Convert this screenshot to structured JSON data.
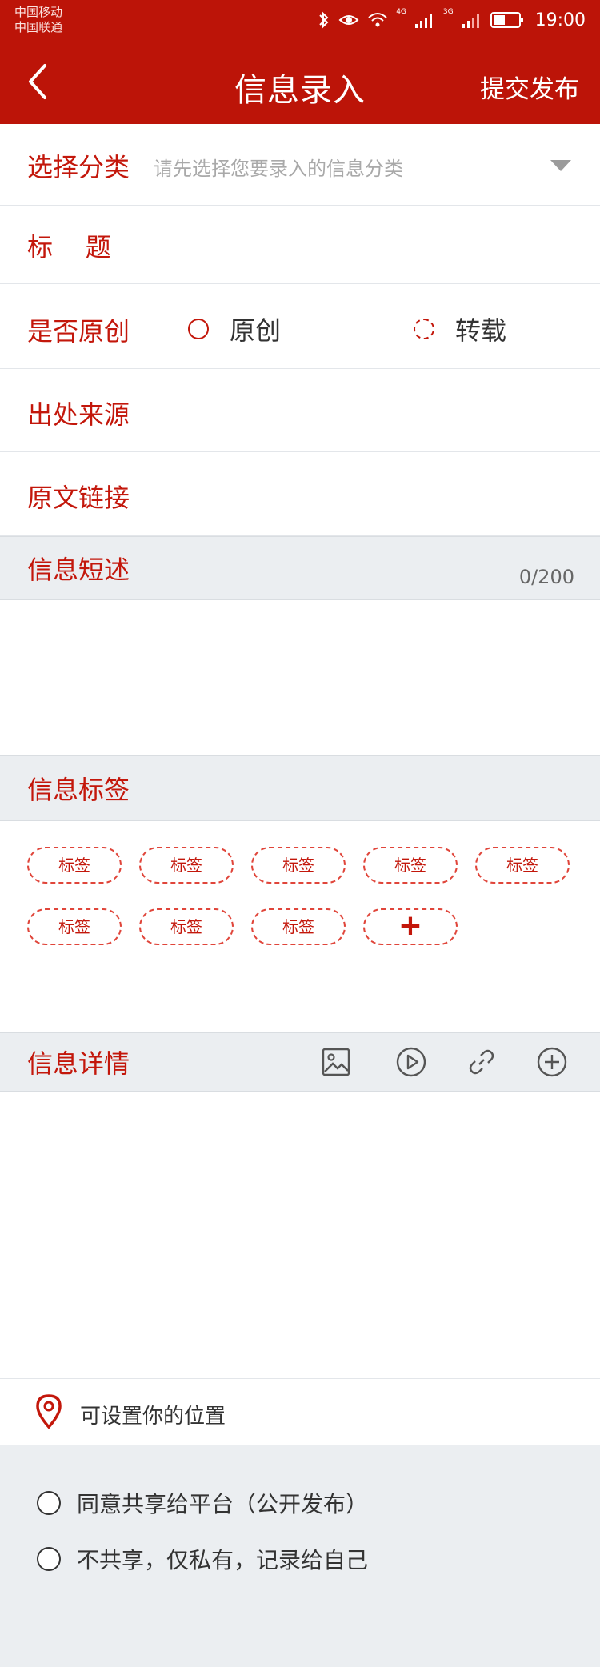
{
  "status_bar": {
    "carrier1": "中国移动",
    "carrier2": "中国联通",
    "net1": "4G",
    "net2": "3G",
    "time": "19:00",
    "icons": [
      "bluetooth-icon",
      "eye-icon",
      "wifi-icon",
      "signal-icon",
      "battery-icon"
    ]
  },
  "nav": {
    "title": "信息录入",
    "submit": "提交发布",
    "back_icon": "chevron-left-icon"
  },
  "form": {
    "category_label": "选择分类",
    "category_placeholder": "请先选择您要录入的信息分类",
    "title_label": "标    题",
    "original_label": "是否原创",
    "option_original": "原创",
    "option_repost": "转载",
    "source_label": "出处来源",
    "link_label": "原文链接"
  },
  "summary": {
    "label": "信息短述",
    "counter": "0/200"
  },
  "tags": {
    "label": "信息标签",
    "items": [
      "标签",
      "标签",
      "标签",
      "标签",
      "标签",
      "标签",
      "标签",
      "标签"
    ],
    "add": "+"
  },
  "details": {
    "label": "信息详情",
    "tools": [
      "image-icon",
      "video-icon",
      "link-icon",
      "add-icon"
    ]
  },
  "location": {
    "text": "可设置你的位置"
  },
  "share": {
    "option_public": "同意共享给平台（公开发布）",
    "option_private": "不共享，仅私有，记录给自己"
  },
  "colors": {
    "brand": "#bc1408",
    "label": "#c3170b",
    "section_bg": "#ebeef1"
  }
}
